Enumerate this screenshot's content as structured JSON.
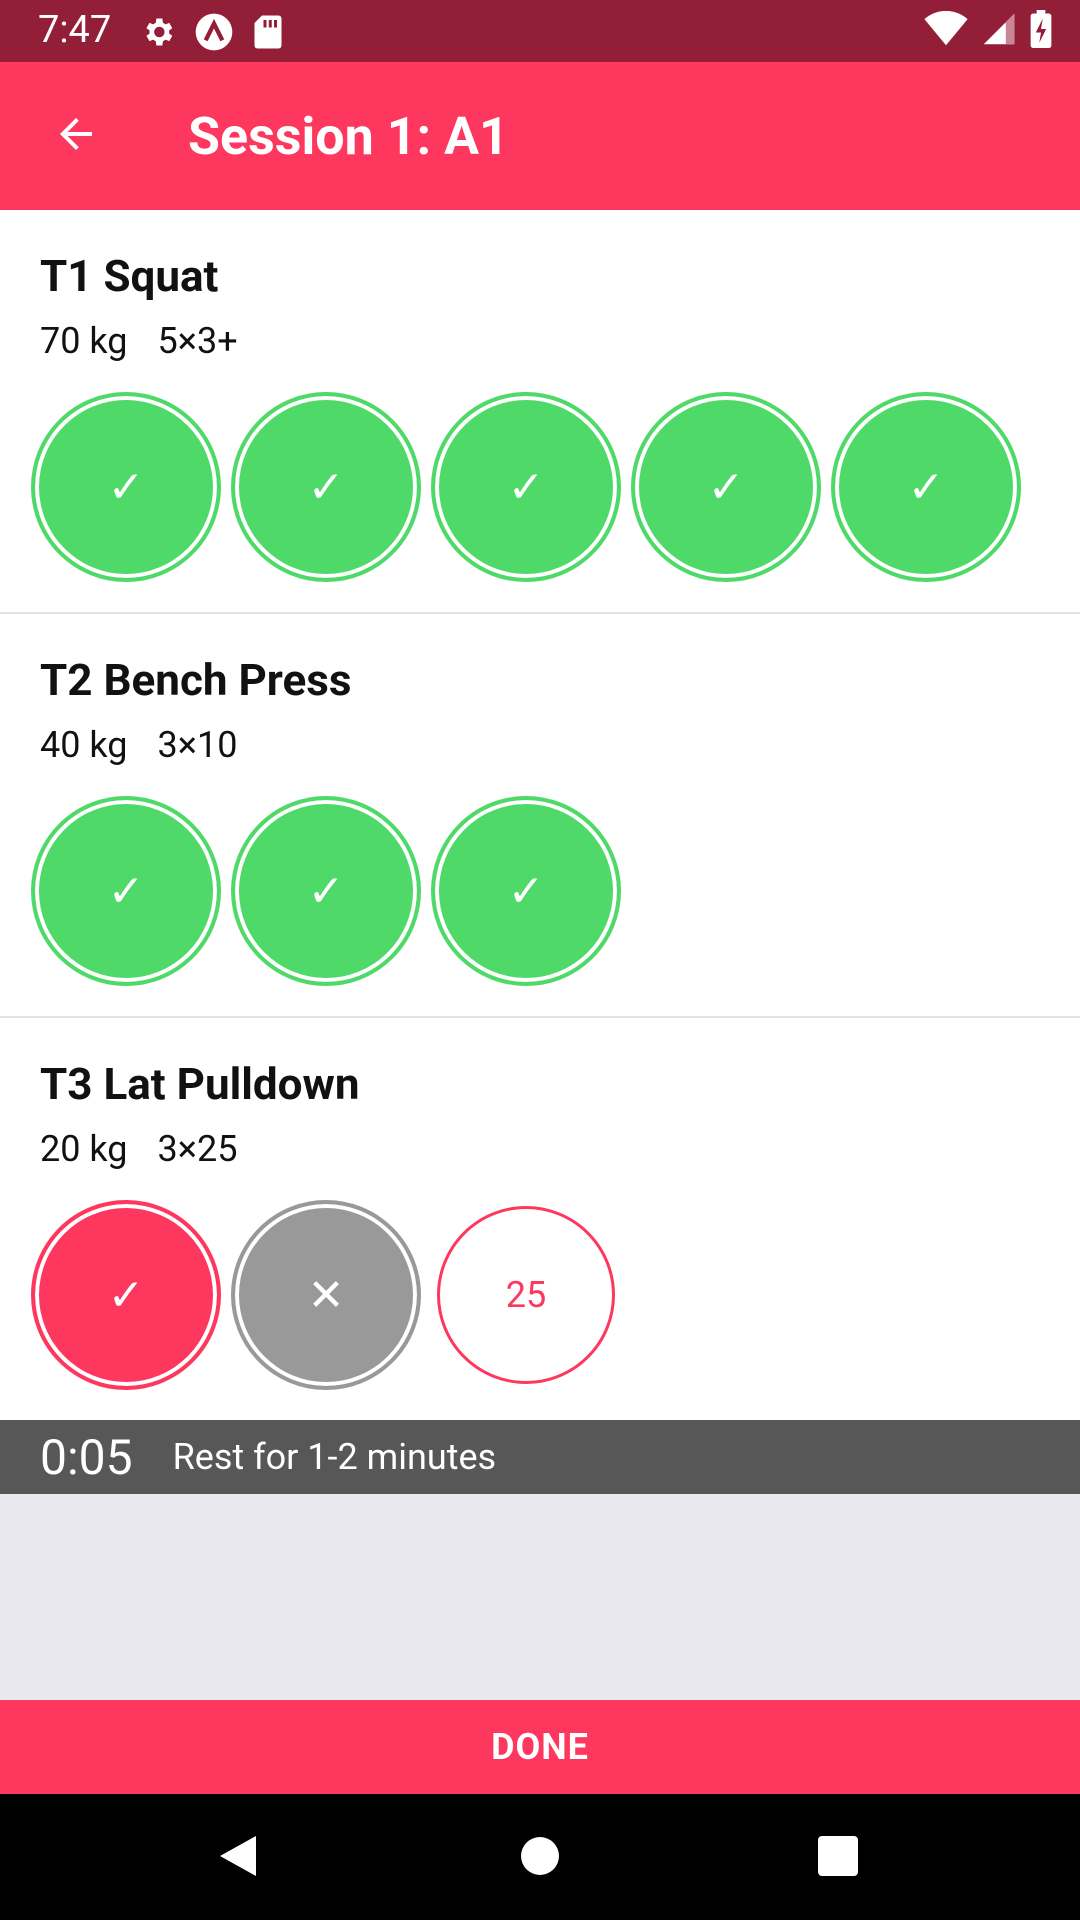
{
  "status_bar": {
    "time": "7:47",
    "left_icons": [
      "gear-icon",
      "app-a-icon",
      "sd-card-icon"
    ],
    "right_icons": [
      "wifi-icon",
      "signal-icon",
      "battery-charging-icon"
    ]
  },
  "app_bar": {
    "title": "Session 1: A1",
    "back_icon": "arrow-left-icon"
  },
  "exercises": [
    {
      "name": "T1 Squat",
      "weight": "70 kg",
      "scheme": "5×3+",
      "sets": [
        {
          "state": "done",
          "label": "✓"
        },
        {
          "state": "done",
          "label": "✓"
        },
        {
          "state": "done",
          "label": "✓"
        },
        {
          "state": "done",
          "label": "✓"
        },
        {
          "state": "done",
          "label": "✓"
        }
      ]
    },
    {
      "name": "T2 Bench Press",
      "weight": "40 kg",
      "scheme": "3×10",
      "sets": [
        {
          "state": "done",
          "label": "✓"
        },
        {
          "state": "done",
          "label": "✓"
        },
        {
          "state": "done",
          "label": "✓"
        }
      ]
    },
    {
      "name": "T3 Lat Pulldown",
      "weight": "20 kg",
      "scheme": "3×25",
      "sets": [
        {
          "state": "done-accent",
          "label": "✓"
        },
        {
          "state": "failed",
          "label": "✕"
        },
        {
          "state": "pending",
          "label": "25"
        }
      ]
    }
  ],
  "rest": {
    "timer": "0:05",
    "message": "Rest for 1-2 minutes"
  },
  "done_button": {
    "label": "DONE"
  },
  "colors": {
    "primary": "#fe375e",
    "status_bar": "#931e37",
    "success": "#4fd968",
    "failed": "#999999",
    "rest_bar": "#575757"
  }
}
